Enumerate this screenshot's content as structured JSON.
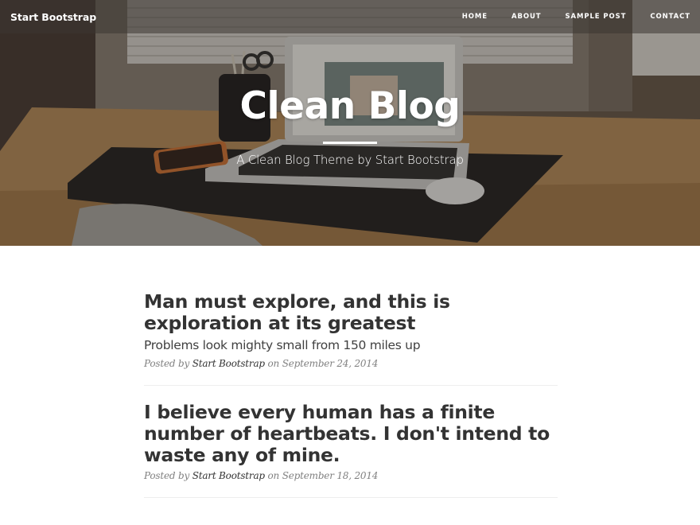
{
  "navbar": {
    "brand": "Start Bootstrap",
    "links": [
      {
        "label": "HOME"
      },
      {
        "label": "ABOUT"
      },
      {
        "label": "SAMPLE POST"
      },
      {
        "label": "CONTACT"
      }
    ]
  },
  "header": {
    "title": "Clean Blog",
    "subtitle": "A Clean Blog Theme by Start Bootstrap"
  },
  "posts": [
    {
      "title": "Man must explore, and this is exploration at its greatest",
      "subtitle": "Problems look mighty small from 150 miles up",
      "meta_prefix": "Posted by",
      "author": "Start Bootstrap",
      "meta_on": "on",
      "date": "September 24, 2014"
    },
    {
      "title": "I believe every human has a finite number of heartbeats. I don't intend to waste any of mine.",
      "meta_prefix": "Posted by",
      "author": "Start Bootstrap",
      "meta_on": "on",
      "date": "September 18, 2014"
    }
  ],
  "colors": {
    "text": "#333333",
    "meta": "#808080",
    "nav_bg": "rgba(60,55,50,0.55)",
    "divider": "#eeeeee"
  }
}
